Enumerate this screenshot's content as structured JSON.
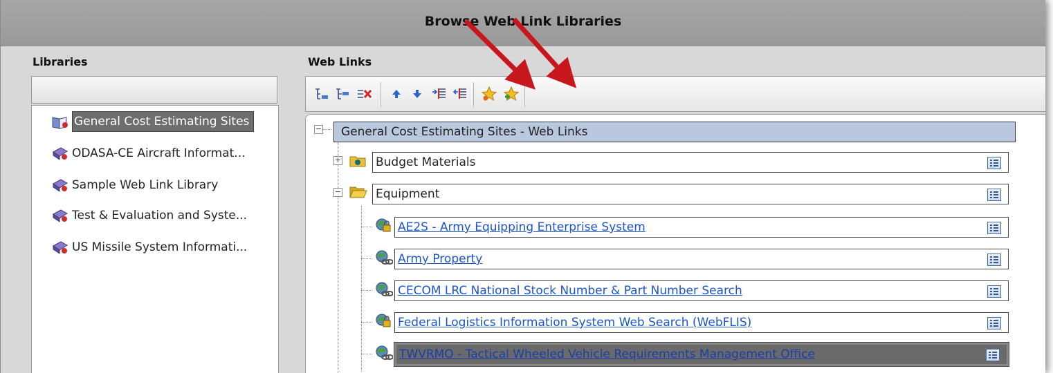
{
  "window": {
    "title": "Browse Web Link Libraries"
  },
  "libraries": {
    "label": "Libraries",
    "items": [
      {
        "label": "General Cost Estimating Sites",
        "icon": "library-open-icon",
        "selected": true
      },
      {
        "label": "ODASA-CE Aircraft Informat...",
        "icon": "library-book-icon",
        "selected": false
      },
      {
        "label": "Sample Web Link Library",
        "icon": "library-book-icon",
        "selected": false
      },
      {
        "label": "Test & Evaluation and Syste...",
        "icon": "library-book-icon",
        "selected": false
      },
      {
        "label": "US Missile System Informati...",
        "icon": "library-book-icon",
        "selected": false
      }
    ]
  },
  "weblinks": {
    "label": "Web Links",
    "toolbar": [
      "add-folder-icon",
      "add-link-icon",
      "delete-icon",
      "move-up-icon",
      "move-down-icon",
      "indent-icon",
      "outdent-icon",
      "favorite-star-icon",
      "add-favorite-star-icon"
    ],
    "tree": {
      "root": "General Cost Estimating Sites - Web Links",
      "folders": [
        {
          "label": "Budget Materials",
          "expanded": false
        },
        {
          "label": "Equipment",
          "expanded": true,
          "links": [
            "AE2S - Army Equipping Enterprise System",
            "Army Property",
            "CECOM LRC National Stock Number & Part Number Search",
            "Federal Logistics Information System Web Search (WebFLIS)",
            "TWVRMO - Tactical Wheeled Vehicle Requirements Management Office"
          ]
        }
      ]
    }
  },
  "colors": {
    "annotation_arrow": "#c8161d",
    "selection": "#6e6e6e",
    "root_highlight": "#b9c8df",
    "link": "#1a55c9"
  }
}
